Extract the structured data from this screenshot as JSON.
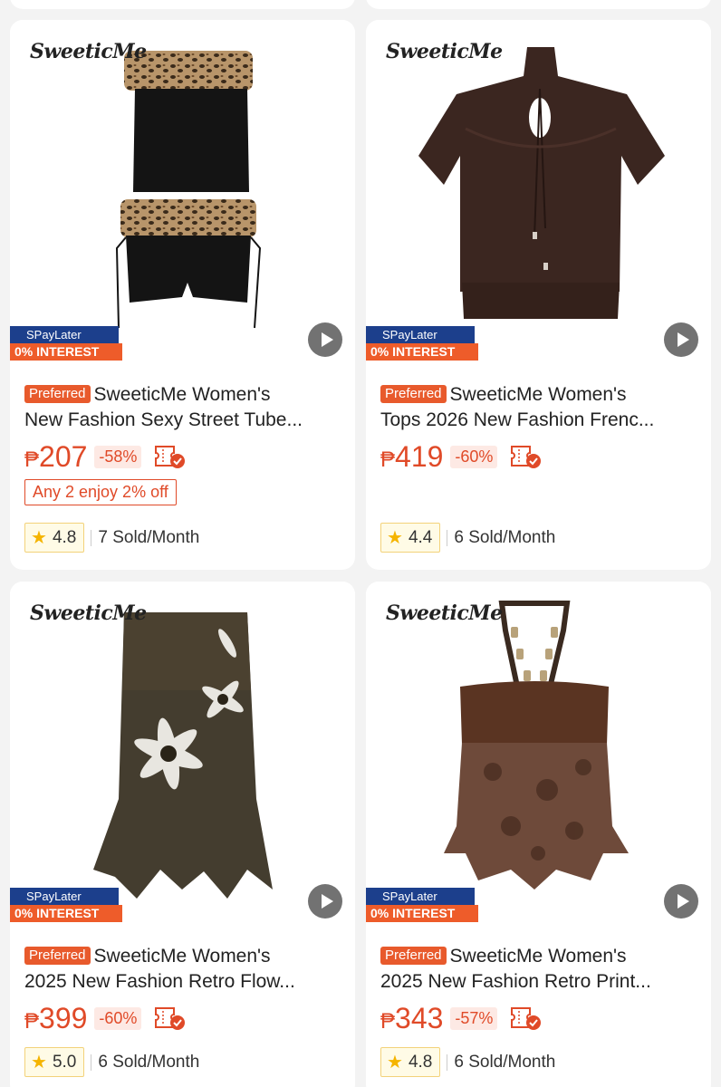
{
  "products": [
    {
      "brand": "SweeticMe",
      "spay_top": "SPayLater",
      "spay_bottom": "0% INTEREST",
      "preferred": "Preferred",
      "title_line1": "SweeticMe Women's",
      "title_line2": "New Fashion Sexy Street Tube...",
      "currency": "₱",
      "price": "207",
      "discount": "-58%",
      "promo": "Any 2 enjoy 2% off",
      "rating": "4.8",
      "sold": "7 Sold/Month",
      "image": "black leopard-fur tube top and skirt set"
    },
    {
      "brand": "SweeticMe",
      "spay_top": "SPayLater",
      "spay_bottom": "0% INTEREST",
      "preferred": "Preferred",
      "title_line1": "SweeticMe Women's",
      "title_line2": "Tops 2026 New Fashion Frenc...",
      "currency": "₱",
      "price": "419",
      "discount": "-60%",
      "rating": "4.4",
      "sold": "6 Sold/Month",
      "image": "brown short-sleeve keyhole top"
    },
    {
      "brand": "SweeticMe",
      "spay_top": "SPayLater",
      "spay_bottom": "0% INTEREST",
      "preferred": "Preferred",
      "title_line1": "SweeticMe Women's",
      "title_line2": "2025 New Fashion Retro Flow...",
      "currency": "₱",
      "price": "399",
      "discount": "-60%",
      "rating": "5.0",
      "sold": "6 Sold/Month",
      "image": "floral mesh asymmetric skirt"
    },
    {
      "brand": "SweeticMe",
      "spay_top": "SPayLater",
      "spay_bottom": "0% INTEREST",
      "preferred": "Preferred",
      "title_line1": "SweeticMe Women's",
      "title_line2": "2025 New Fashion Retro Print...",
      "currency": "₱",
      "price": "343",
      "discount": "-57%",
      "rating": "4.8",
      "sold": "6 Sold/Month",
      "image": "brown halter printed mesh top"
    }
  ],
  "colors": {
    "accent": "#e04a28",
    "spay_blue": "#1c3f8c",
    "spay_orange": "#ee5c2a",
    "star": "#f5b400"
  },
  "icons": {
    "voucher": "voucher-check-icon",
    "play": "play-icon",
    "star": "star-icon"
  }
}
